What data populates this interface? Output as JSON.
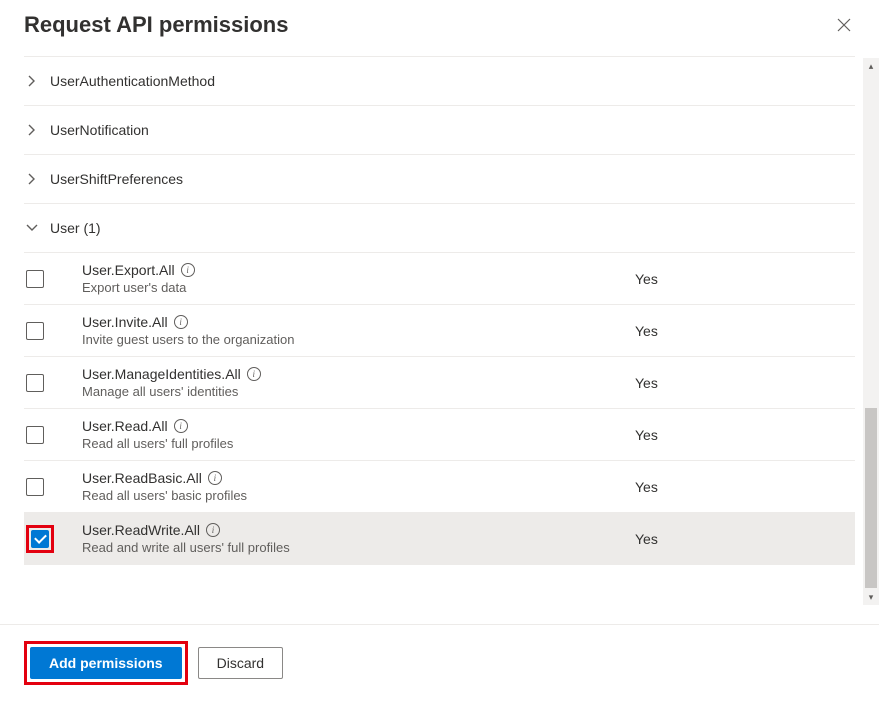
{
  "header": {
    "title": "Request API permissions"
  },
  "sections": {
    "s0": {
      "label": "UserAuthenticationMethod"
    },
    "s1": {
      "label": "UserNotification"
    },
    "s2": {
      "label": "UserShiftPreferences"
    },
    "s3": {
      "label": "User (1)"
    }
  },
  "permissions": {
    "p0": {
      "name": "User.Export.All",
      "desc": "Export user's data",
      "admin": "Yes"
    },
    "p1": {
      "name": "User.Invite.All",
      "desc": "Invite guest users to the organization",
      "admin": "Yes"
    },
    "p2": {
      "name": "User.ManageIdentities.All",
      "desc": "Manage all users' identities",
      "admin": "Yes"
    },
    "p3": {
      "name": "User.Read.All",
      "desc": "Read all users' full profiles",
      "admin": "Yes"
    },
    "p4": {
      "name": "User.ReadBasic.All",
      "desc": "Read all users' basic profiles",
      "admin": "Yes"
    },
    "p5": {
      "name": "User.ReadWrite.All",
      "desc": "Read and write all users' full profiles",
      "admin": "Yes"
    }
  },
  "footer": {
    "add_label": "Add permissions",
    "discard_label": "Discard"
  }
}
